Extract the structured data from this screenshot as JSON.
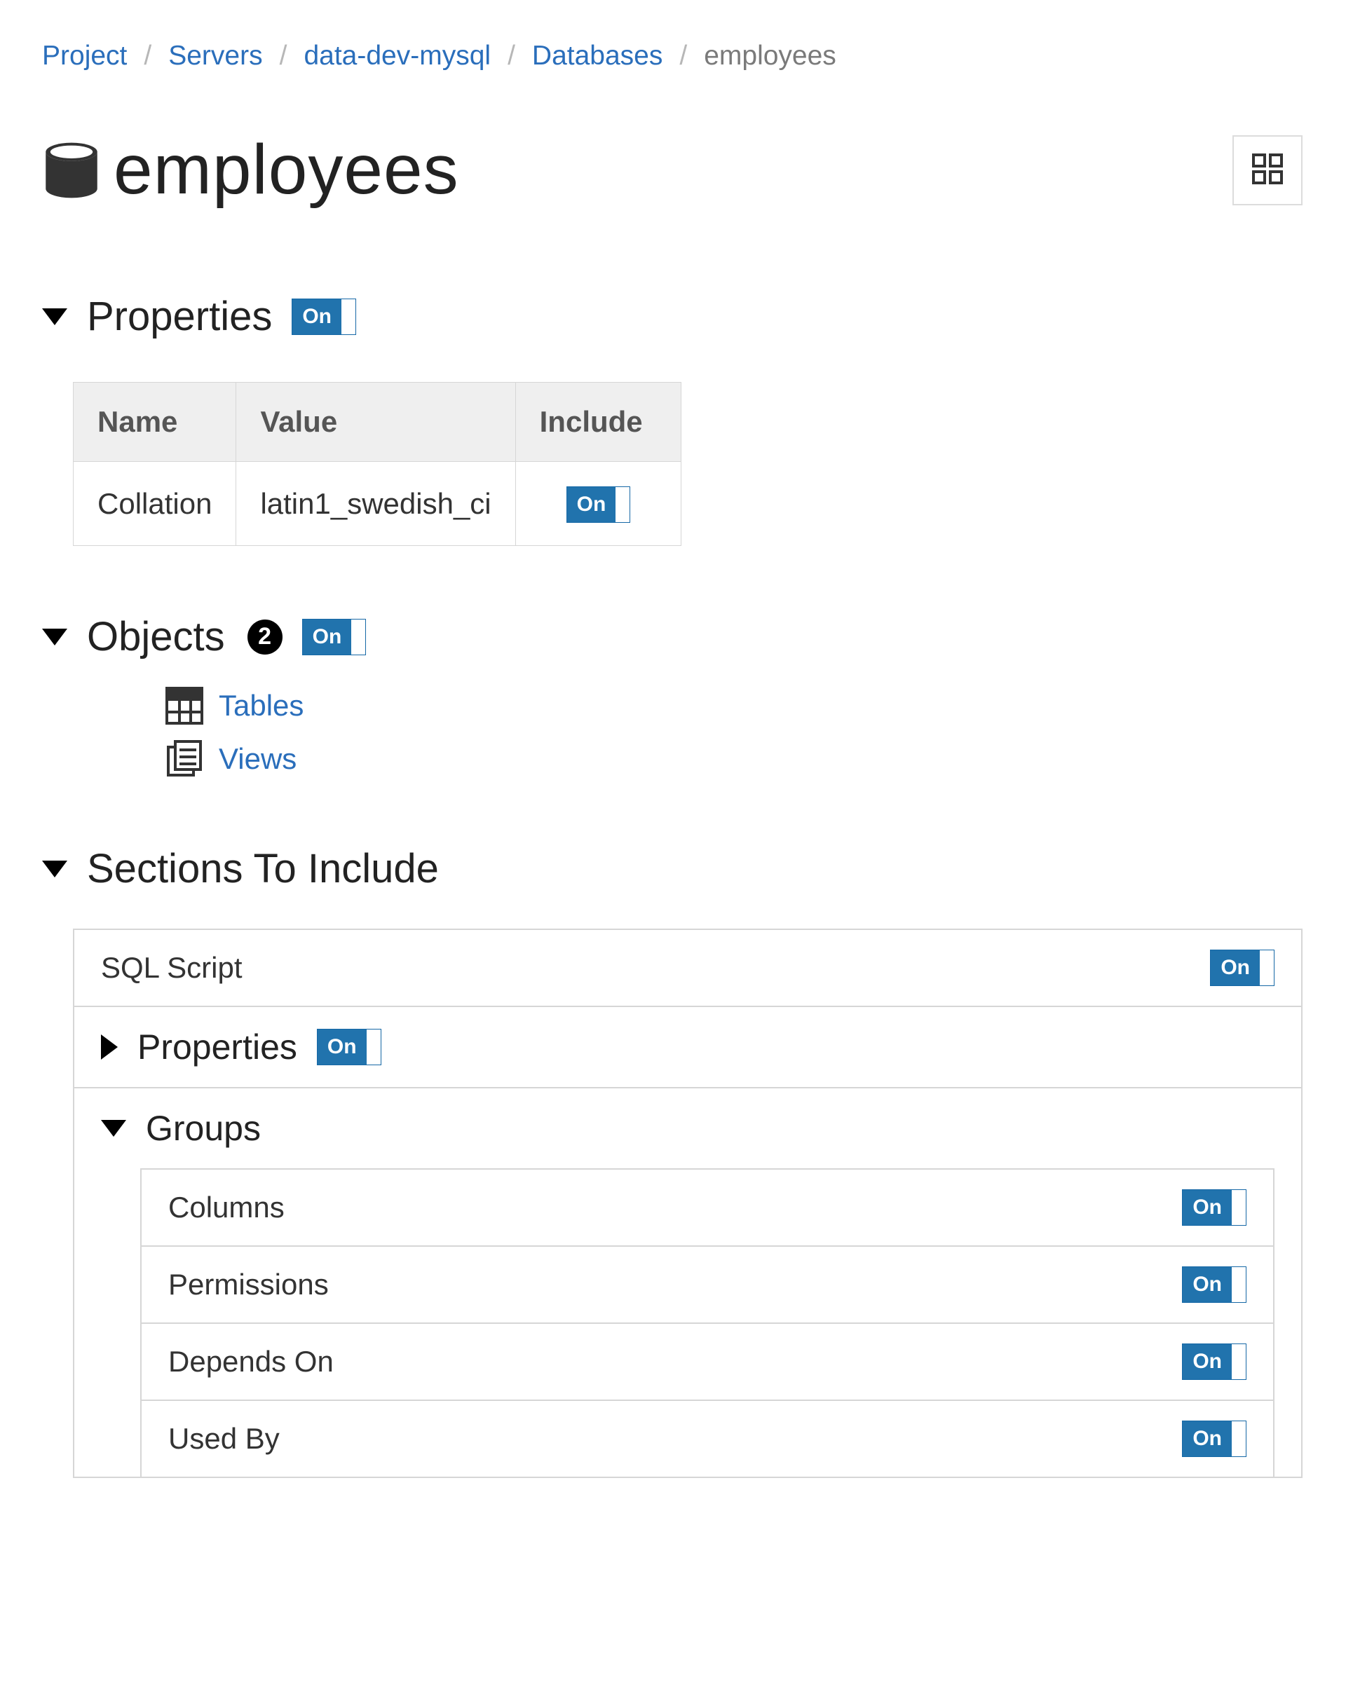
{
  "breadcrumb": {
    "items": [
      "Project",
      "Servers",
      "data-dev-mysql",
      "Databases"
    ],
    "current": "employees"
  },
  "page": {
    "title": "employees"
  },
  "toggle": {
    "on": "On"
  },
  "properties": {
    "heading": "Properties",
    "cols": {
      "name": "Name",
      "value": "Value",
      "include": "Include"
    },
    "rows": [
      {
        "name": "Collation",
        "value": "latin1_swedish_ci"
      }
    ]
  },
  "objects": {
    "heading": "Objects",
    "count": "2",
    "items": [
      {
        "label": "Tables",
        "icon": "table"
      },
      {
        "label": "Views",
        "icon": "view"
      }
    ]
  },
  "sections": {
    "heading": "Sections To Include",
    "sql": "SQL Script",
    "properties": "Properties",
    "groups": {
      "heading": "Groups",
      "items": [
        "Columns",
        "Permissions",
        "Depends On",
        "Used By"
      ]
    }
  }
}
